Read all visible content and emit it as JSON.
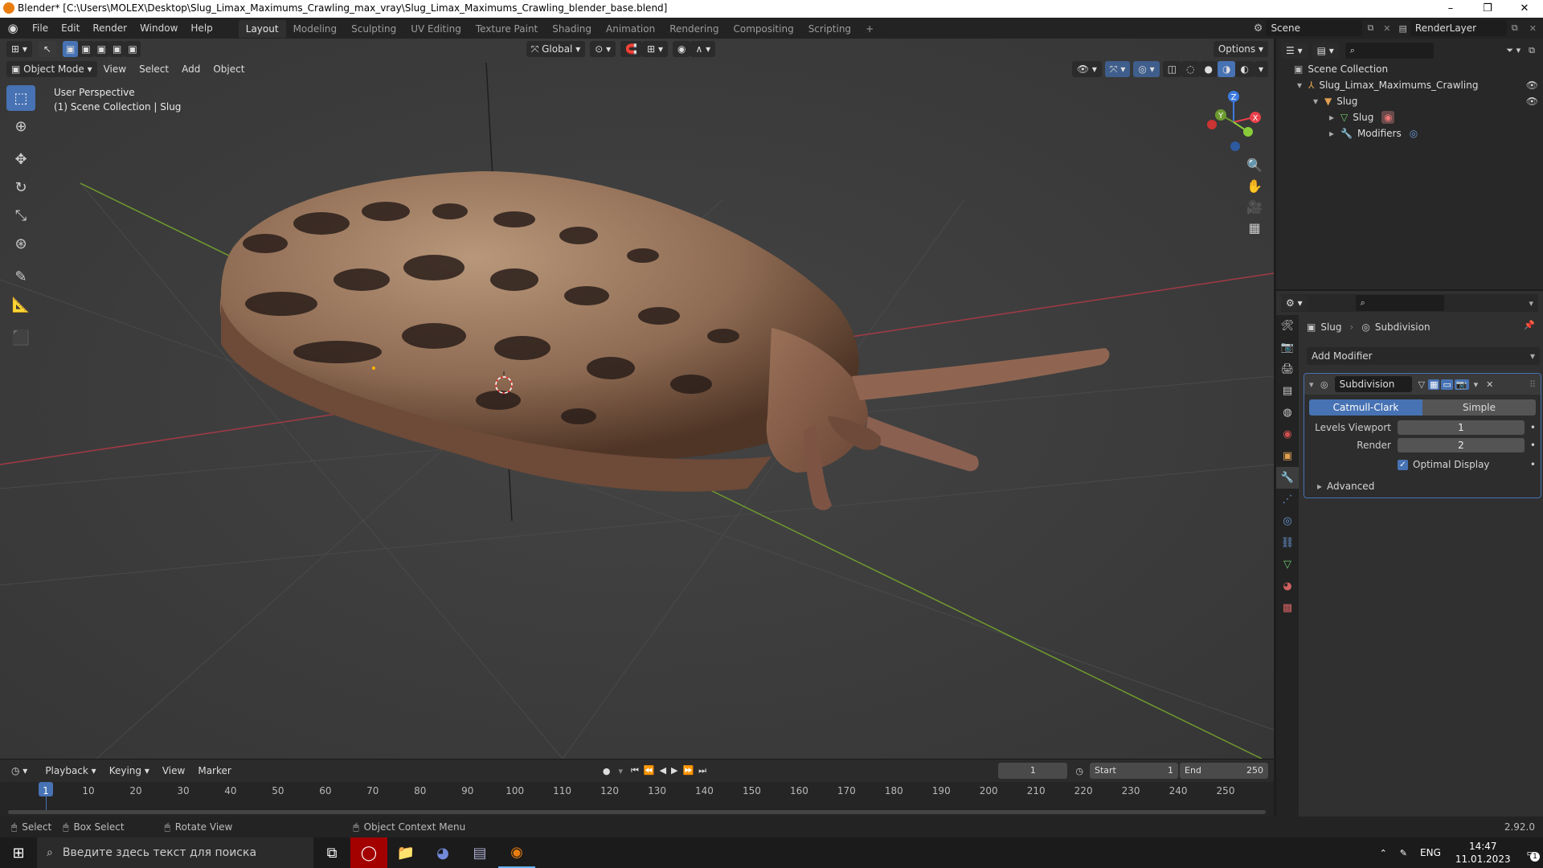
{
  "window": {
    "title": "Blender* [C:\\Users\\MOLEX\\Desktop\\Slug_Limax_Maximums_Crawling_max_vray\\Slug_Limax_Maximums_Crawling_blender_base.blend]",
    "minimize": "–",
    "maximize": "❐",
    "close": "✕"
  },
  "menubar": {
    "items": [
      "File",
      "Edit",
      "Render",
      "Window",
      "Help"
    ],
    "workspaces": [
      "Layout",
      "Modeling",
      "Sculpting",
      "UV Editing",
      "Texture Paint",
      "Shading",
      "Animation",
      "Rendering",
      "Compositing",
      "Scripting"
    ],
    "add_tab": "+",
    "scene": "Scene",
    "render_layer": "RenderLayer"
  },
  "viewport": {
    "mode": "Object Mode",
    "menus": [
      "View",
      "Select",
      "Add",
      "Object"
    ],
    "transform_orientation": "Global",
    "options": "Options",
    "overlay_line1": "User Perspective",
    "overlay_line2": "(1) Scene Collection | Slug",
    "gizmo": {
      "z": "Z",
      "y": "Y",
      "x": "X"
    }
  },
  "timeline": {
    "menus": [
      "Playback",
      "Keying",
      "View",
      "Marker"
    ],
    "current_frame": "1",
    "start_label": "Start",
    "start": "1",
    "end_label": "End",
    "end": "250",
    "ticks": [
      "1",
      "10",
      "20",
      "30",
      "40",
      "50",
      "60",
      "70",
      "80",
      "90",
      "100",
      "110",
      "120",
      "130",
      "140",
      "150",
      "160",
      "170",
      "180",
      "190",
      "200",
      "210",
      "220",
      "230",
      "240",
      "250"
    ]
  },
  "statusbar": {
    "select": "Select",
    "box_select": "Box Select",
    "rotate_view": "Rotate View",
    "context_menu": "Object Context Menu",
    "version": "2.92.0"
  },
  "outliner": {
    "root": "Scene Collection",
    "collection": "Slug_Limax_Maximums_Crawling",
    "object": "Slug",
    "mesh": "Slug",
    "modifiers": "Modifiers"
  },
  "properties": {
    "breadcrumb_object": "Slug",
    "breadcrumb_modifier": "Subdivision",
    "add_modifier": "Add Modifier",
    "modifier_name": "Subdivision",
    "type_catmull": "Catmull-Clark",
    "type_simple": "Simple",
    "levels_viewport_label": "Levels Viewport",
    "levels_viewport": "1",
    "render_label": "Render",
    "render": "2",
    "optimal_display": "Optimal Display",
    "advanced": "Advanced"
  },
  "taskbar": {
    "search_placeholder": "Введите здесь текст для поиска",
    "lang": "ENG",
    "time": "14:47",
    "date": "11.01.2023",
    "notif_count": "1"
  },
  "colors": {
    "accent": "#4772b3",
    "x_axis": "#e8404a",
    "y_axis": "#8acb3a",
    "z_axis": "#3d7be0"
  }
}
